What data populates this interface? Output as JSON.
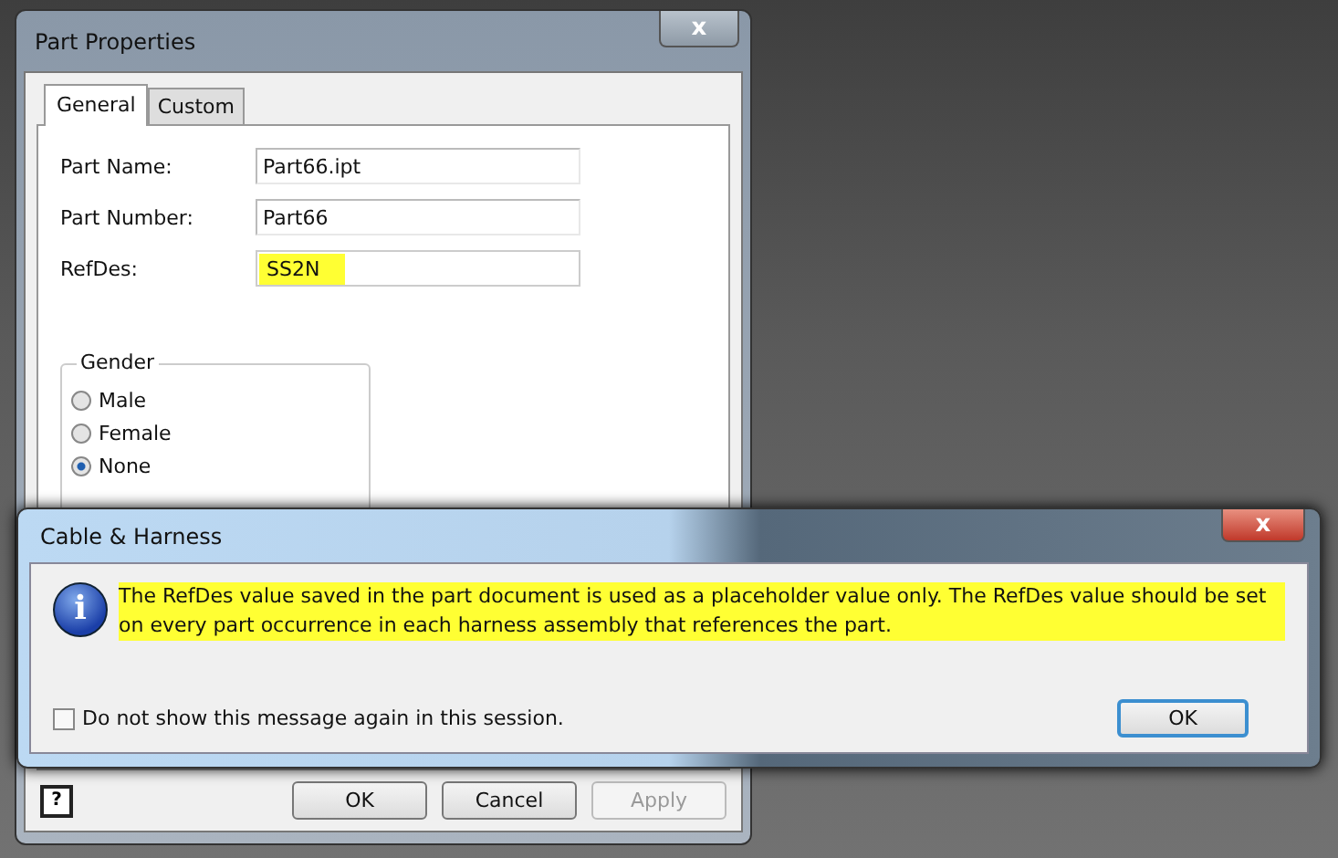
{
  "part_properties": {
    "title": "Part Properties",
    "close": "x",
    "tabs": [
      {
        "label": "General",
        "selected": true
      },
      {
        "label": "Custom",
        "selected": false
      }
    ],
    "fields": [
      {
        "label": "Part Name:",
        "value": "Part66.ipt",
        "highlighted": false
      },
      {
        "label": "Part Number:",
        "value": "Part66",
        "highlighted": false
      },
      {
        "label": "RefDes:",
        "value": "SS2N",
        "highlighted": true
      }
    ],
    "gender": {
      "title": "Gender",
      "options": [
        {
          "label": "Male",
          "selected": false
        },
        {
          "label": "Female",
          "selected": false
        },
        {
          "label": "None",
          "selected": true
        }
      ]
    },
    "help": "?",
    "buttons": [
      {
        "label": "OK",
        "disabled": false
      },
      {
        "label": "Cancel",
        "disabled": false
      },
      {
        "label": "Apply",
        "disabled": true
      }
    ]
  },
  "message": {
    "title": "Cable & Harness",
    "close": "x",
    "icon_letter": "i",
    "text": "The RefDes value saved in the part document is used as a placeholder value only.  The RefDes value should be set on every part occurrence in each harness assembly that references the part.",
    "highlighted": true,
    "checkbox": {
      "label": "Do not show this message again in this session.",
      "checked": false
    },
    "button": "OK"
  }
}
